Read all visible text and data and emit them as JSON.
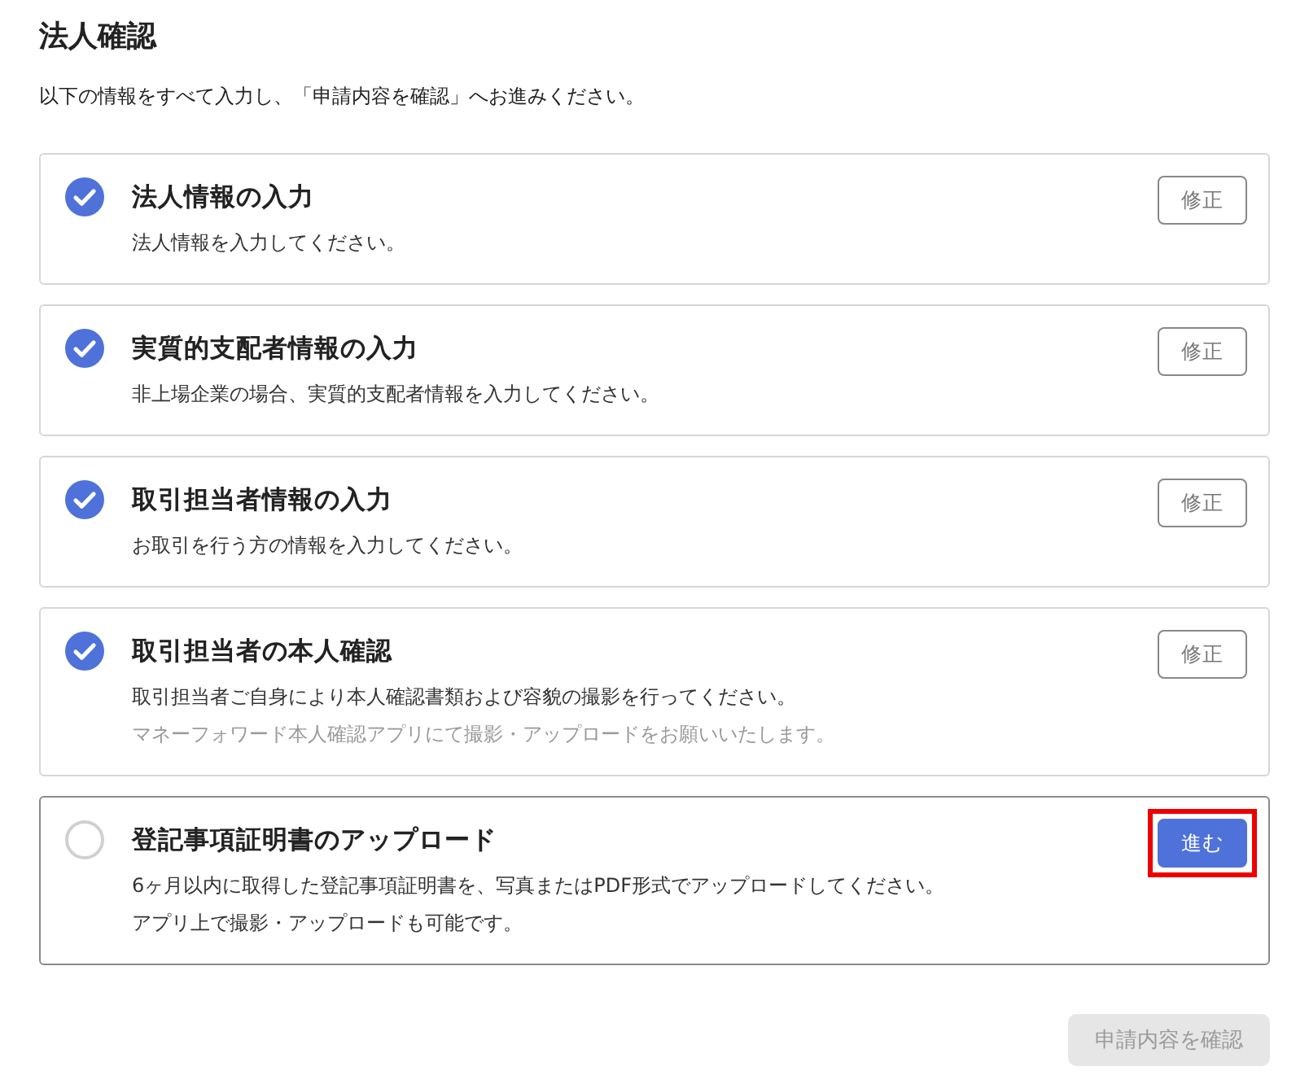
{
  "title": "法人確認",
  "intro": "以下の情報をすべて入力し、「申請内容を確認」へお進みください。",
  "steps": [
    {
      "title": "法人情報の入力",
      "done": true,
      "lines": [
        {
          "text": "法人情報を入力してください。",
          "muted": false
        }
      ],
      "action": {
        "kind": "edit",
        "label": "修正",
        "highlighted": false
      }
    },
    {
      "title": "実質的支配者情報の入力",
      "done": true,
      "lines": [
        {
          "text": "非上場企業の場合、実質的支配者情報を入力してください。",
          "muted": false
        }
      ],
      "action": {
        "kind": "edit",
        "label": "修正",
        "highlighted": false
      }
    },
    {
      "title": "取引担当者情報の入力",
      "done": true,
      "lines": [
        {
          "text": "お取引を行う方の情報を入力してください。",
          "muted": false
        }
      ],
      "action": {
        "kind": "edit",
        "label": "修正",
        "highlighted": false
      }
    },
    {
      "title": "取引担当者の本人確認",
      "done": true,
      "lines": [
        {
          "text": "取引担当者ご自身により本人確認書類および容貌の撮影を行ってください。",
          "muted": false
        },
        {
          "text": "マネーフォワード本人確認アプリにて撮影・アップロードをお願いいたします。",
          "muted": true
        }
      ],
      "action": {
        "kind": "edit",
        "label": "修正",
        "highlighted": false
      }
    },
    {
      "title": "登記事項証明書のアップロード",
      "done": false,
      "lines": [
        {
          "text": "6ヶ月以内に取得した登記事項証明書を、写真またはPDF形式でアップロードしてください。",
          "muted": false
        },
        {
          "text": "アプリ上で撮影・アップロードも可能です。",
          "muted": false
        }
      ],
      "action": {
        "kind": "proceed",
        "label": "進む",
        "highlighted": true
      }
    }
  ],
  "confirm": {
    "label": "申請内容を確認",
    "disabled": true
  }
}
